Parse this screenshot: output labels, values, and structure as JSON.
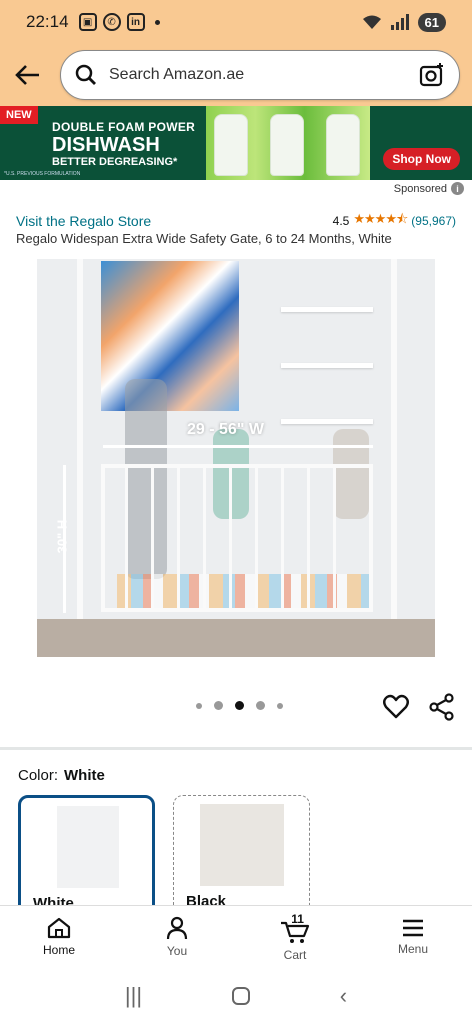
{
  "status_bar": {
    "time": "22:14",
    "battery": "61"
  },
  "search": {
    "placeholder": "Search Amazon.ae"
  },
  "banner": {
    "badge": "NEW",
    "line1": "DOUBLE FOAM POWER",
    "line2": "DISHWASH",
    "line3": "BETTER DEGREASING*",
    "fine_print": "*U.S. PREVIOUS FORMULATION",
    "cta": "Shop Now",
    "colors": {
      "background": "#0b5138",
      "cta": "#d61f26"
    }
  },
  "sponsored_label": "Sponsored",
  "product": {
    "store_link": "Visit the Regalo Store",
    "rating": "4.5",
    "stars": "★★★★⯪",
    "rating_count": "(95,967)",
    "title": "Regalo Widespan Extra Wide Safety Gate, 6 to 24 Months, White",
    "image_width_label": "29 - 56\" W",
    "image_height_label": "30\" H",
    "carousel_active_index": 2
  },
  "color": {
    "label": "Color:",
    "selected": "White",
    "swatches": [
      {
        "name": "White"
      },
      {
        "name": "Black"
      }
    ]
  },
  "bottom_nav": [
    {
      "label": "Home",
      "icon": "home-icon",
      "active": true
    },
    {
      "label": "You",
      "icon": "person-icon"
    },
    {
      "label": "Cart",
      "icon": "cart-icon",
      "badge": "11"
    },
    {
      "label": "Menu",
      "icon": "menu-icon"
    }
  ],
  "accent_colors": {
    "header": "#f9c992",
    "link": "#007185",
    "star": "#e77600",
    "selected_border": "#0b4f86"
  }
}
